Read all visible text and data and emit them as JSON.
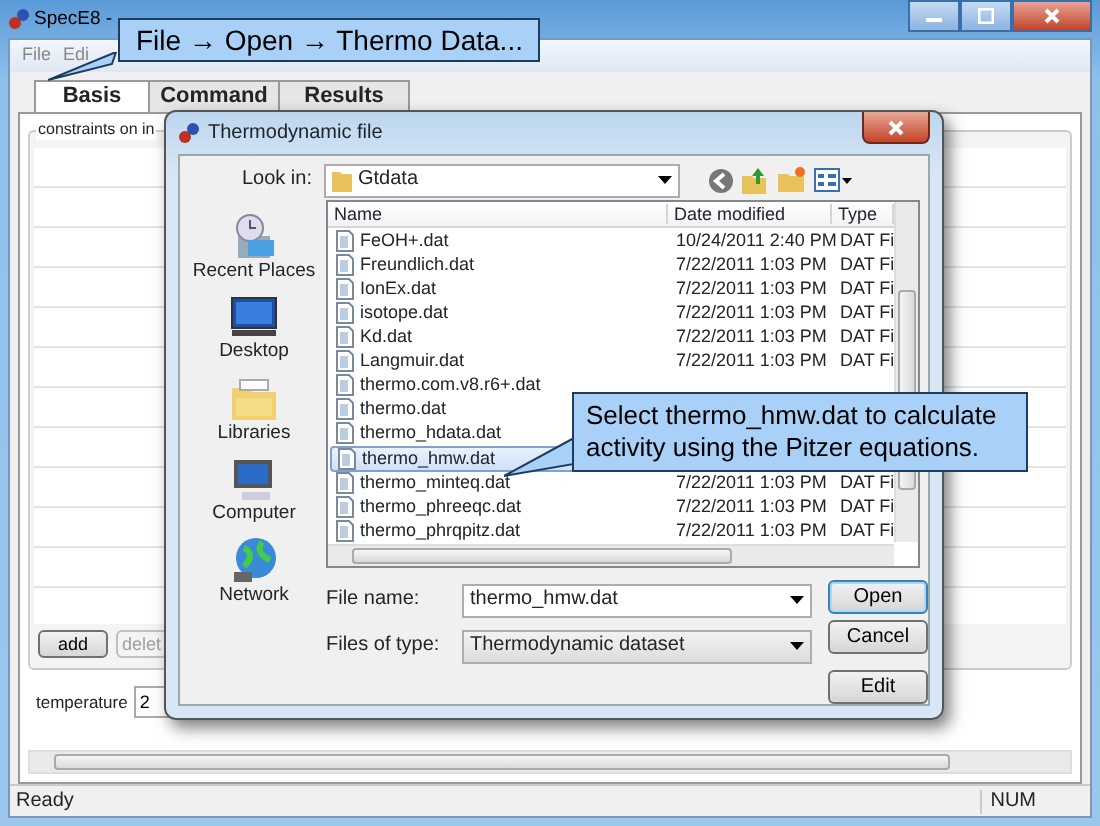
{
  "window": {
    "title": "SpecE8 -"
  },
  "menu": [
    "File",
    "Edi"
  ],
  "tabs": [
    {
      "label": "Basis",
      "selected": true
    },
    {
      "label": "Command",
      "selected": false
    },
    {
      "label": "Results",
      "selected": false
    }
  ],
  "constraints_group": {
    "title": "constraints on in",
    "buttons": [
      {
        "label": "add",
        "disabled": false
      },
      {
        "label": "delet",
        "disabled": true
      }
    ]
  },
  "temperature": {
    "label": "temperature",
    "value": "2"
  },
  "status_bar": {
    "message": "Ready",
    "indicator": "NUM"
  },
  "dialog": {
    "title": "Thermodynamic file",
    "look_in_label": "Look in:",
    "look_in": "Gtdata",
    "places": [
      {
        "label": "Recent Places",
        "kind": "recent"
      },
      {
        "label": "Desktop",
        "kind": "desktop"
      },
      {
        "label": "Libraries",
        "kind": "libraries"
      },
      {
        "label": "Computer",
        "kind": "computer"
      },
      {
        "label": "Network",
        "kind": "network"
      }
    ],
    "columns": [
      "Name",
      "Date modified",
      "Type"
    ],
    "files": [
      {
        "name": "FeOH+.dat",
        "date_modified": "10/24/2011 2:40 PM",
        "type": "DAT Fi",
        "selected": false
      },
      {
        "name": "Freundlich.dat",
        "date_modified": "7/22/2011 1:03 PM",
        "type": "DAT Fi",
        "selected": false
      },
      {
        "name": "IonEx.dat",
        "date_modified": "7/22/2011 1:03 PM",
        "type": "DAT Fi",
        "selected": false
      },
      {
        "name": "isotope.dat",
        "date_modified": "7/22/2011 1:03 PM",
        "type": "DAT Fi",
        "selected": false
      },
      {
        "name": "Kd.dat",
        "date_modified": "7/22/2011 1:03 PM",
        "type": "DAT Fi",
        "selected": false
      },
      {
        "name": "Langmuir.dat",
        "date_modified": "7/22/2011 1:03 PM",
        "type": "DAT Fi",
        "selected": false
      },
      {
        "name": "thermo.com.v8.r6+.dat",
        "selected": false
      },
      {
        "name": "thermo.dat",
        "selected": false
      },
      {
        "name": "thermo_hdata.dat",
        "selected": false
      },
      {
        "name": "thermo_hmw.dat",
        "selected": true
      },
      {
        "name": "thermo_minteq.dat",
        "date_modified": "7/22/2011 1:03 PM",
        "type": "DAT Fi",
        "selected": false
      },
      {
        "name": "thermo_phreeqc.dat",
        "date_modified": "7/22/2011 1:03 PM",
        "type": "DAT Fi",
        "selected": false
      },
      {
        "name": "thermo_phrqpitz.dat",
        "date_modified": "7/22/2011 1:03 PM",
        "type": "DAT Fi",
        "selected": false
      }
    ],
    "file_name_label": "File name:",
    "file_name": "thermo_hmw.dat",
    "files_of_type_label": "Files of type:",
    "files_of_type": "Thermodynamic dataset",
    "buttons": [
      "Open",
      "Cancel",
      "Edit"
    ]
  },
  "callouts": [
    {
      "text": "File → Open → Thermo Data..."
    },
    {
      "text": "Select thermo_hmw.dat to calculate activity using the Pitzer equations."
    }
  ]
}
